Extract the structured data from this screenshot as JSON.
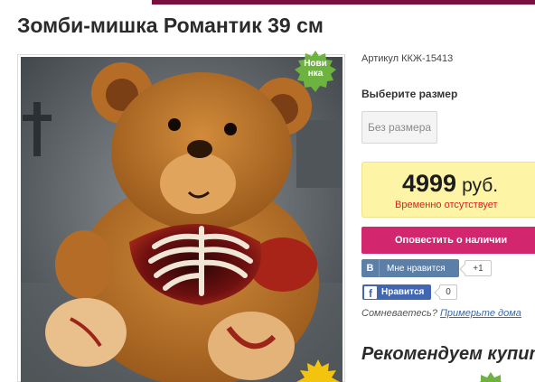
{
  "product": {
    "title": "Зомби-мишка Романтик 39 см",
    "badge_new": "Новинка",
    "sku": "Артикул ККЖ-15413",
    "size_heading": "Выберите размер",
    "size_option": "Без размера",
    "price_value": "4999",
    "price_currency": "руб.",
    "stock_status": "Временно отсутствует",
    "notify_label": "Оповестить о наличии"
  },
  "social": {
    "vk_logo": "B",
    "vk_label": "Мне нравится",
    "vk_count": "+1",
    "fb_logo": "f",
    "fb_label": "Нравится",
    "fb_count": "0"
  },
  "doubt": {
    "text": "Сомневаетесь?",
    "link": "Примерьте дома"
  },
  "recommend": {
    "heading": "Рекомендуем купить"
  },
  "colors": {
    "accent_pink": "#d2276f",
    "price_bg": "#fdf4a6",
    "stock_red": "#d81f1f",
    "badge_green": "#6db33f",
    "vk_blue": "#5b7fa6",
    "fb_blue": "#4267b2"
  },
  "icons": {
    "badge_new": "green-starburst-badge",
    "badge_star": "yellow-starburst-badge",
    "vk": "vk-logo",
    "fb": "facebook-logo"
  }
}
